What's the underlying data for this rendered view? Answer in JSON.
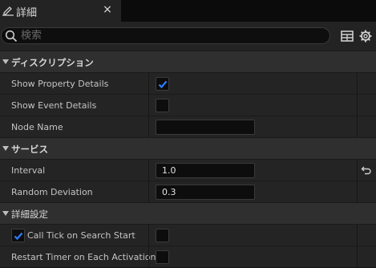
{
  "tab": {
    "title": "詳細",
    "close": "×",
    "icon": "edit-pencil-icon"
  },
  "toolbar": {
    "search_placeholder": "検索",
    "icons": [
      "grid-view-icon",
      "gear-icon"
    ]
  },
  "sections": [
    {
      "label": "ディスクリプション",
      "rows": [
        {
          "name": "Show Property Details",
          "checked": true
        },
        {
          "name": "Show Event Details",
          "checked": false
        },
        {
          "name": "Node Name",
          "value": ""
        }
      ]
    },
    {
      "label": "サービス",
      "rows": [
        {
          "name": "Interval",
          "value": "1.0"
        },
        {
          "name": "Random Deviation",
          "value": "0.3"
        }
      ]
    },
    {
      "label": "詳細設定",
      "rows": [
        {
          "name": "Call Tick on Search Start",
          "label_checkbox_checked": true,
          "checked": false
        },
        {
          "name": "Restart Timer on Each Activation",
          "checked": false
        }
      ]
    }
  ],
  "colors": {
    "accent": "#2b7fff",
    "panel": "#242424",
    "section": "#2f2f2f"
  }
}
